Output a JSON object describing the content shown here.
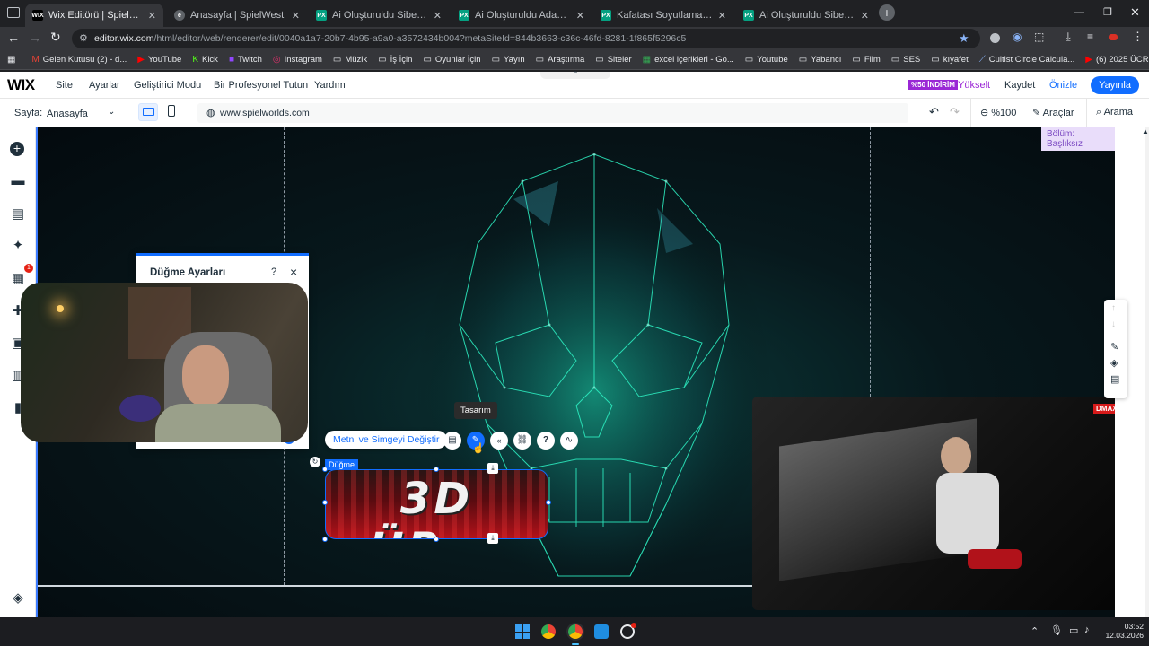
{
  "browser": {
    "tabs": [
      {
        "label": "Wix Editörü | SpielWest",
        "active": true,
        "fav": "WIX"
      },
      {
        "label": "Anasayfa | SpielWest",
        "active": false,
        "fav": "e"
      },
      {
        "label": "Ai Oluşturuldu Siberpunk Şehir",
        "active": false,
        "fav": "PX"
      },
      {
        "label": "Ai Oluşturuldu Adam Binalar - F",
        "active": false,
        "fav": "PX"
      },
      {
        "label": "Kafatası Soyutlama Neon Işık -",
        "active": false,
        "fav": "PX"
      },
      {
        "label": "Ai Oluşturuldu Siber Neon Geo",
        "active": false,
        "fav": "PX"
      }
    ],
    "url_host": "editor.wix.com",
    "url_path": "/html/editor/web/renderer/edit/0040a1a7-20b7-4b95-a9a0-a3572434b004?metaSiteId=844b3663-c36c-46fd-8281-1f865f5296c5",
    "bookmarks": [
      {
        "label": "Gelen Kutusu (2) - d...",
        "icon": "gmail-icon",
        "glyph": "M",
        "color": "#ea4335"
      },
      {
        "label": "YouTube",
        "icon": "youtube-icon",
        "glyph": "▶",
        "color": "#ff0000"
      },
      {
        "label": "Kick",
        "icon": "kick-icon",
        "glyph": "K",
        "color": "#53fc18"
      },
      {
        "label": "Twitch",
        "icon": "twitch-icon",
        "glyph": "■",
        "color": "#9146ff"
      },
      {
        "label": "Instagram",
        "icon": "instagram-icon",
        "glyph": "◎",
        "color": "#e1306c"
      },
      {
        "label": "Müzik",
        "icon": "folder-icon",
        "glyph": "▭",
        "color": "#e8eaed"
      },
      {
        "label": "İş İçin",
        "icon": "folder-icon",
        "glyph": "▭",
        "color": "#e8eaed"
      },
      {
        "label": "Oyunlar İçin",
        "icon": "folder-icon",
        "glyph": "▭",
        "color": "#e8eaed"
      },
      {
        "label": "Yayın",
        "icon": "folder-icon",
        "glyph": "▭",
        "color": "#e8eaed"
      },
      {
        "label": "Araştırma",
        "icon": "folder-icon",
        "glyph": "▭",
        "color": "#e8eaed"
      },
      {
        "label": "Siteler",
        "icon": "folder-icon",
        "glyph": "▭",
        "color": "#e8eaed"
      },
      {
        "label": "excel içerikleri - Go...",
        "icon": "sheets-icon",
        "glyph": "▦",
        "color": "#34a853"
      },
      {
        "label": "Youtube",
        "icon": "folder-icon",
        "glyph": "▭",
        "color": "#e8eaed"
      },
      {
        "label": "Yabancı",
        "icon": "folder-icon",
        "glyph": "▭",
        "color": "#e8eaed"
      },
      {
        "label": "Film",
        "icon": "folder-icon",
        "glyph": "▭",
        "color": "#e8eaed"
      },
      {
        "label": "SES",
        "icon": "folder-icon",
        "glyph": "▭",
        "color": "#e8eaed"
      },
      {
        "label": "kıyafet",
        "icon": "folder-icon",
        "glyph": "▭",
        "color": "#e8eaed"
      },
      {
        "label": "Cultist Circle Calcula...",
        "icon": "link-icon",
        "glyph": "⟋",
        "color": "#8ab4f8"
      },
      {
        "label": "(6) 2025 ÜCRETSİZ...",
        "icon": "youtube-icon",
        "glyph": "▶",
        "color": "#ff0000"
      }
    ]
  },
  "wix": {
    "logo": "WIX",
    "menu": [
      "Site",
      "Ayarlar",
      "Geliştirici Modu",
      "Bir Profesyonel Tutun",
      "Yardım"
    ],
    "discount_badge": "%50 İNDİRİM",
    "upgrade": "Yükselt",
    "save": "Kaydet",
    "preview": "Önizle",
    "publish": "Yayınla",
    "page_label": "Sayfa:",
    "page_value": "Anasayfa",
    "domain": "www.spielworlds.com",
    "zoom": "%100",
    "tools": "Araçlar",
    "search": "Arama",
    "section_label": "Bölüm: Başlıksız",
    "apps_badge": "1",
    "accent": "#116dff"
  },
  "button_settings": {
    "title": "Düğme Ayarları",
    "help": "?",
    "close": "×"
  },
  "toolbar": {
    "change_text": "Metni ve Simgeyi Değiştir",
    "tooltip": "Tasarım"
  },
  "selected": {
    "label": "Düğme",
    "text": "3D ÜR..."
  },
  "stream": {
    "channel_logo": "DMAX"
  },
  "taskbar": {
    "time": "03:52",
    "date": "12.03.2026"
  }
}
